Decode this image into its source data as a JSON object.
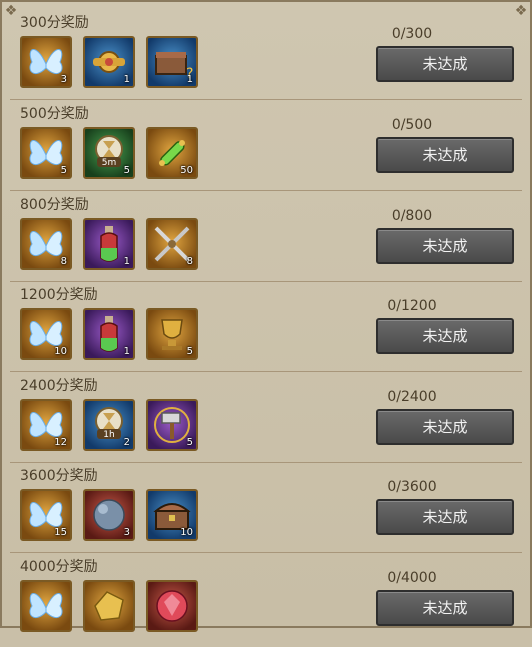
{
  "rewards": [
    {
      "title": "300分奖励",
      "progress": "0/300",
      "button": "未达成",
      "items": [
        {
          "icon": "butterfly-icon",
          "bg": "gold",
          "count": "3"
        },
        {
          "icon": "golden-gear-icon",
          "bg": "blue",
          "count": "1"
        },
        {
          "icon": "mystery-chest-icon",
          "bg": "blue",
          "count": "1"
        }
      ]
    },
    {
      "title": "500分奖励",
      "progress": "0/500",
      "button": "未达成",
      "items": [
        {
          "icon": "butterfly-icon",
          "bg": "gold",
          "count": "5"
        },
        {
          "icon": "speedup-5m-icon",
          "bg": "green",
          "count": "5",
          "label": "5m"
        },
        {
          "icon": "green-scroll-icon",
          "bg": "gold",
          "count": "50"
        }
      ]
    },
    {
      "title": "800分奖励",
      "progress": "0/800",
      "button": "未达成",
      "items": [
        {
          "icon": "butterfly-icon",
          "bg": "gold",
          "count": "8"
        },
        {
          "icon": "potion-icon",
          "bg": "purple",
          "count": "1"
        },
        {
          "icon": "crossed-swords-icon",
          "bg": "gold",
          "count": "8"
        }
      ]
    },
    {
      "title": "1200分奖励",
      "progress": "0/1200",
      "button": "未达成",
      "items": [
        {
          "icon": "butterfly-icon",
          "bg": "gold",
          "count": "10"
        },
        {
          "icon": "potion-icon",
          "bg": "purple",
          "count": "1"
        },
        {
          "icon": "golden-trophy-icon",
          "bg": "gold",
          "count": "5"
        }
      ]
    },
    {
      "title": "2400分奖励",
      "progress": "0/2400",
      "button": "未达成",
      "items": [
        {
          "icon": "butterfly-icon",
          "bg": "gold",
          "count": "12"
        },
        {
          "icon": "speedup-1h-icon",
          "bg": "blue",
          "count": "2",
          "label": "1h"
        },
        {
          "icon": "hammer-icon",
          "bg": "purple",
          "count": "5"
        }
      ]
    },
    {
      "title": "3600分奖励",
      "progress": "0/3600",
      "button": "未达成",
      "items": [
        {
          "icon": "butterfly-icon",
          "bg": "gold",
          "count": "15"
        },
        {
          "icon": "stone-orb-icon",
          "bg": "red",
          "count": "3"
        },
        {
          "icon": "treasure-chest-icon",
          "bg": "blue",
          "count": "10"
        }
      ]
    },
    {
      "title": "4000分奖励",
      "progress": "0/4000",
      "button": "未达成",
      "items": [
        {
          "icon": "butterfly-icon",
          "bg": "gold",
          "count": ""
        },
        {
          "icon": "gold-ore-icon",
          "bg": "gold",
          "count": ""
        },
        {
          "icon": "red-gem-icon",
          "bg": "red",
          "count": ""
        }
      ]
    }
  ]
}
